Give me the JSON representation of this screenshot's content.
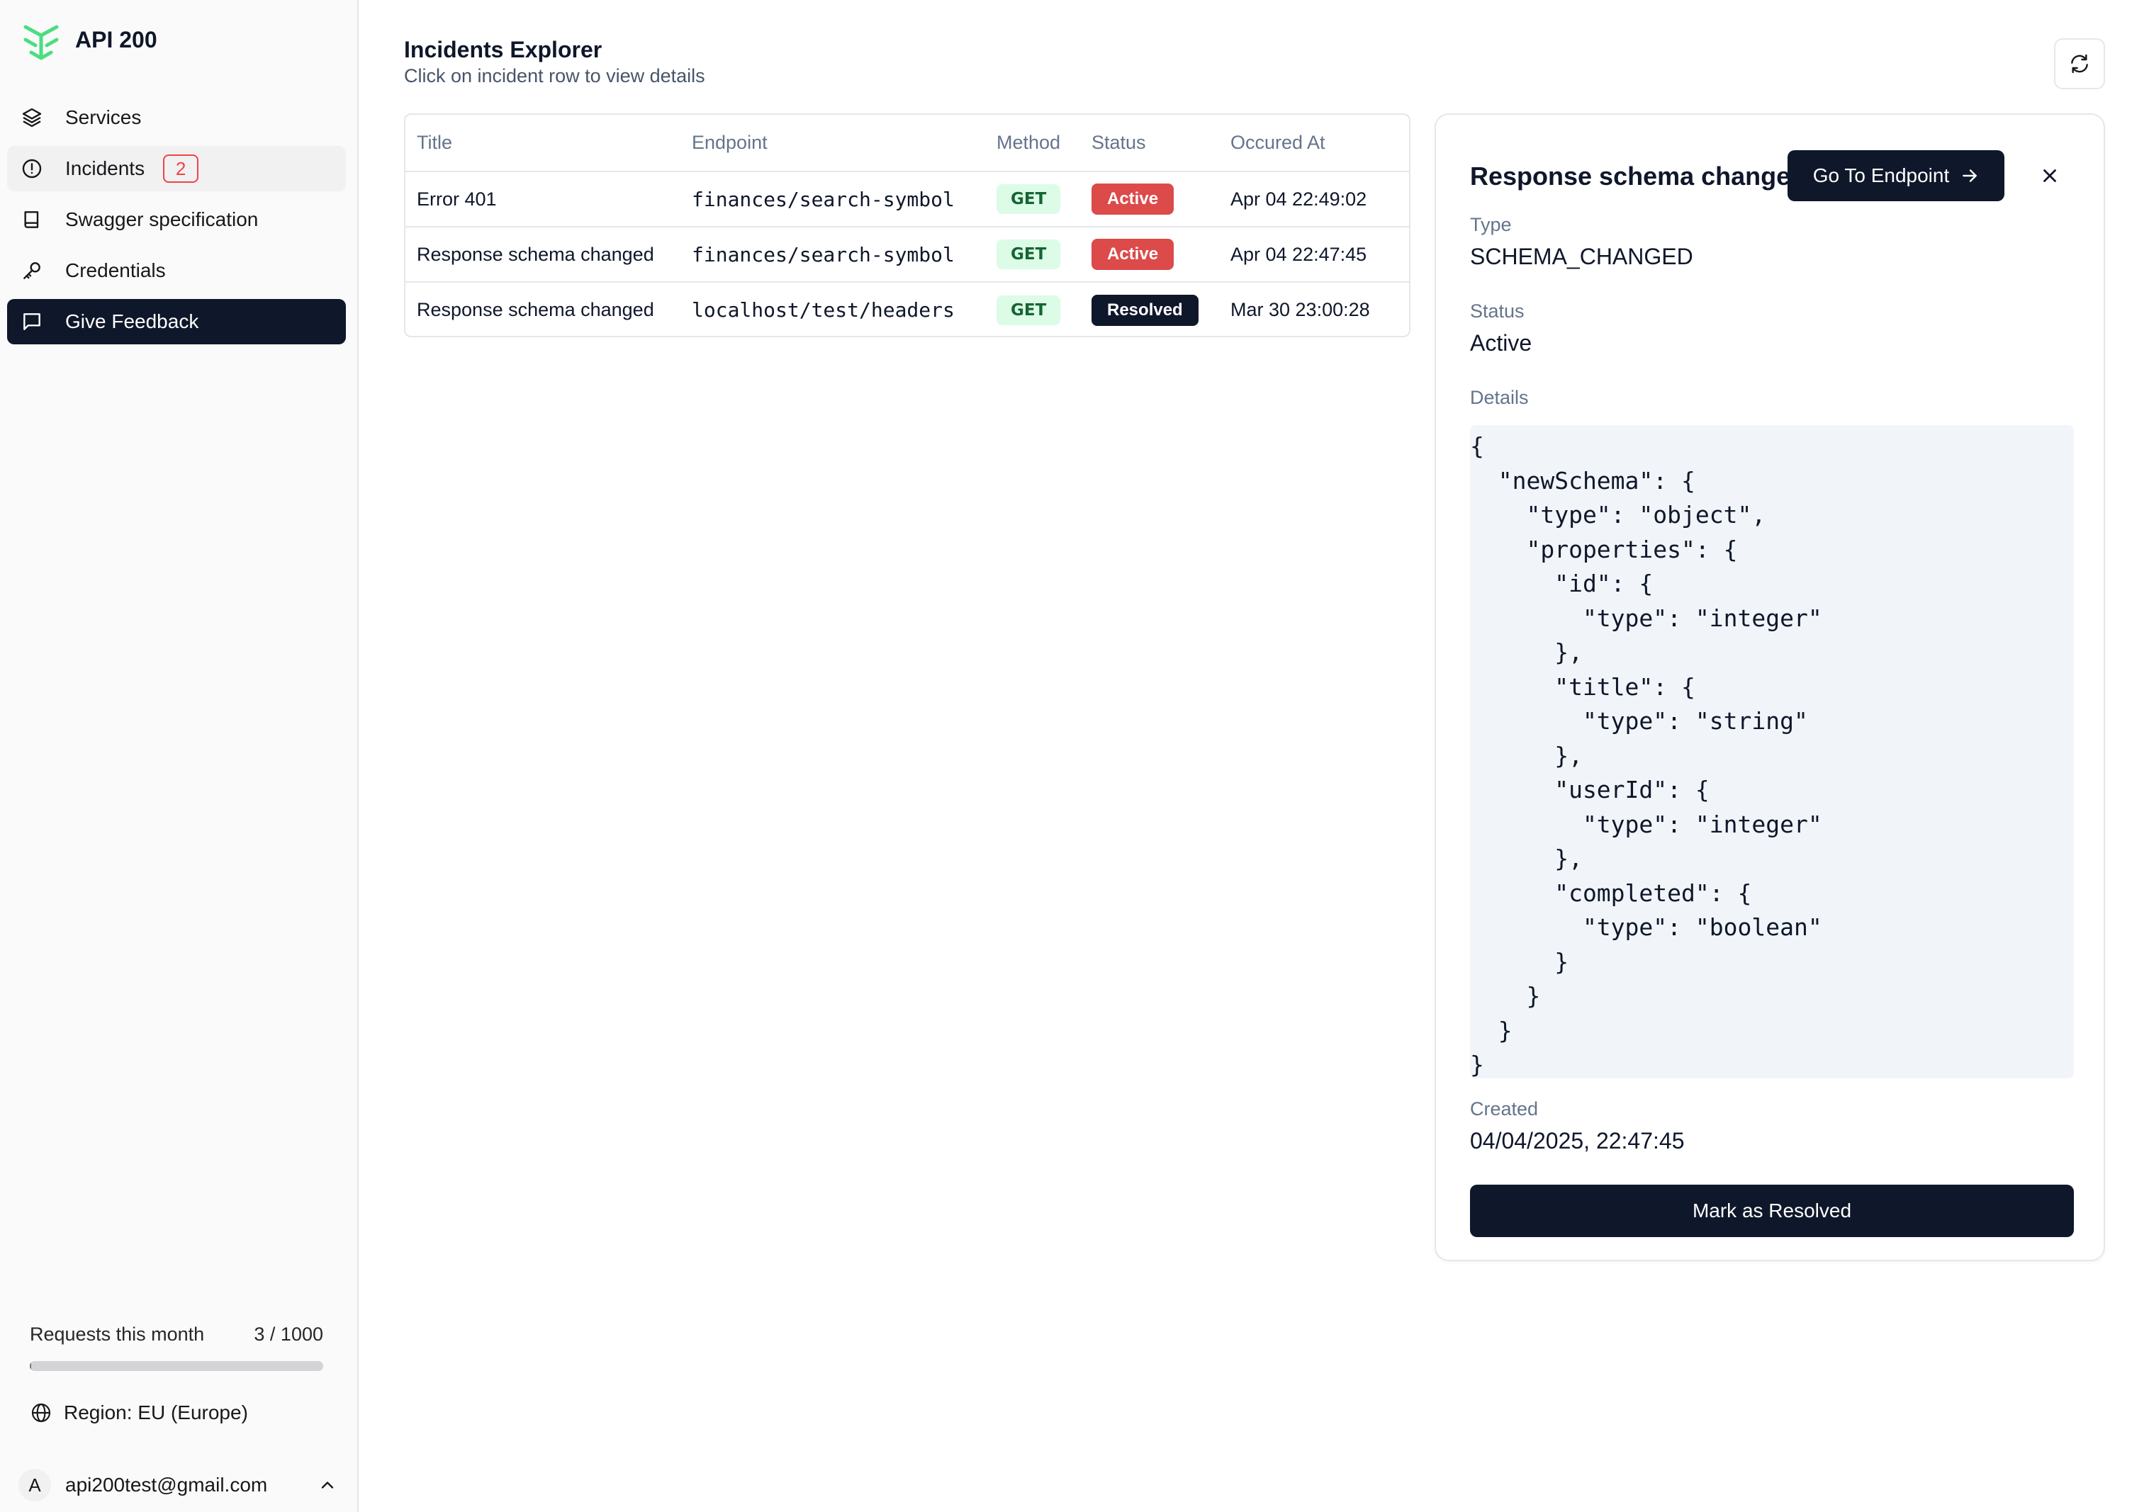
{
  "app": {
    "name": "API 200",
    "accent": "#4ade80"
  },
  "sidebar": {
    "items": [
      {
        "label": "Services",
        "icon": "layers-icon"
      },
      {
        "label": "Incidents",
        "icon": "alert-circle-icon",
        "badge": "2"
      },
      {
        "label": "Swagger specification",
        "icon": "book-icon"
      },
      {
        "label": "Credentials",
        "icon": "key-icon"
      },
      {
        "label": "Give Feedback",
        "icon": "message-square-icon"
      }
    ],
    "usage": {
      "label": "Requests this month",
      "value": "3 / 1000",
      "fraction": 0.003
    },
    "region": {
      "label": "Region: EU (Europe)",
      "icon": "globe-icon"
    },
    "account": {
      "initial": "A",
      "email": "api200test@gmail.com",
      "icon": "chevron-up-icon"
    }
  },
  "header": {
    "title": "Incidents Explorer",
    "subtitle": "Click on incident row to view details",
    "refresh_icon": "refresh-icon"
  },
  "table": {
    "columns": [
      "Title",
      "Endpoint",
      "Method",
      "Status",
      "Occured At"
    ],
    "rows": [
      {
        "title": "Error 401",
        "endpoint": "finances/search-symbol",
        "method": "GET",
        "status": "Active",
        "occurred": "Apr 04 22:49:02"
      },
      {
        "title": "Response schema changed",
        "endpoint": "finances/search-symbol",
        "method": "GET",
        "status": "Active",
        "occurred": "Apr 04 22:47:45"
      },
      {
        "title": "Response schema changed",
        "endpoint": "localhost/test/headers",
        "method": "GET",
        "status": "Resolved",
        "occurred": "Mar 30 23:00:28"
      }
    ],
    "colors": {
      "active": "#dc4a4a",
      "resolved": "#0f172a",
      "method_bg": "#dcfce7",
      "method_fg": "#166534"
    }
  },
  "detail": {
    "title": "Response schema changed",
    "goto_label": "Go To Endpoint",
    "type_label": "Type",
    "type_value": "SCHEMA_CHANGED",
    "status_label": "Status",
    "status_value": "Active",
    "details_label": "Details",
    "details_json": "{\n  \"newSchema\": {\n    \"type\": \"object\",\n    \"properties\": {\n      \"id\": {\n        \"type\": \"integer\"\n      },\n      \"title\": {\n        \"type\": \"string\"\n      },\n      \"userId\": {\n        \"type\": \"integer\"\n      },\n      \"completed\": {\n        \"type\": \"boolean\"\n      }\n    }\n  }\n}",
    "created_label": "Created",
    "created_value": "04/04/2025, 22:47:45",
    "resolve_label": "Mark as Resolved"
  }
}
